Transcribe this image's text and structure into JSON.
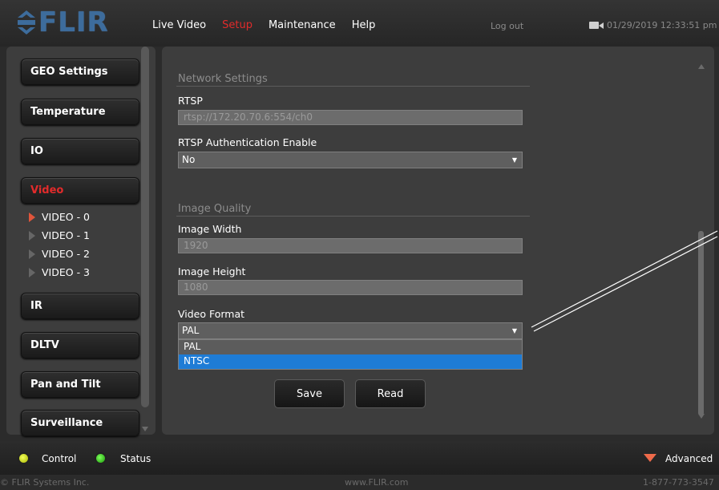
{
  "brand": {
    "logo_text": "FLIR"
  },
  "nav": {
    "items": [
      "Live Video",
      "Setup",
      "Maintenance",
      "Help"
    ],
    "logout": "Log out",
    "datetime": "01/29/2019 12:33:51 pm"
  },
  "sidebar": {
    "buttons": [
      "GEO Settings",
      "Temperature",
      "IO",
      "Video",
      "IR",
      "DLTV",
      "Pan and Tilt",
      "Surveillance"
    ],
    "video_items": [
      "VIDEO - 0",
      "VIDEO - 1",
      "VIDEO - 2",
      "VIDEO - 3"
    ]
  },
  "network": {
    "title": "Network Settings",
    "rtsp_label": "RTSP",
    "rtsp_value": "rtsp://172.20.70.6:554/ch0",
    "auth_label": "RTSP Authentication Enable",
    "auth_value": "No"
  },
  "image": {
    "title": "Image Quality",
    "width_label": "Image Width",
    "width_value": "1920",
    "height_label": "Image Height",
    "height_value": "1080",
    "format_label": "Video Format",
    "format_value": "PAL",
    "format_options": [
      "PAL",
      "NTSC"
    ]
  },
  "buttons": {
    "save": "Save",
    "read": "Read"
  },
  "status": {
    "control": "Control",
    "status": "Status",
    "advanced": "Advanced"
  },
  "footer": {
    "copyright": "© FLIR Systems Inc.",
    "website": "www.FLIR.com",
    "phone": "1-877-773-3547"
  },
  "colors": {
    "accent_red": "#e22b2b",
    "selection_blue": "#1e7cd6",
    "logo_blue": "#3d6c9c"
  }
}
